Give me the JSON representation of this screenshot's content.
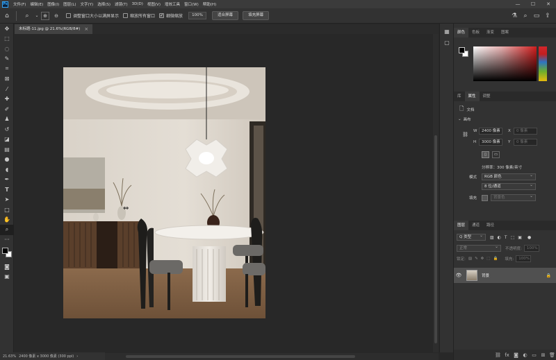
{
  "app": {
    "logo": "Ps",
    "menus": [
      "文件(F)",
      "编辑(E)",
      "图像(I)",
      "图层(L)",
      "文字(Y)",
      "选择(S)",
      "滤镜(T)",
      "3D(D)",
      "视图(V)",
      "增效工具",
      "窗口(W)",
      "帮助(H)"
    ],
    "window_controls": [
      "—",
      "☐",
      "✕"
    ]
  },
  "options_bar": {
    "checkbox_resize": "调整窗口大小以满屏显示",
    "checkbox_all_windows": "缩放所有窗口",
    "checkbox_scrubby": "细微缩放",
    "zoom_value": "100%",
    "fit_button": "适合屏幕",
    "fill_button": "填充屏幕"
  },
  "document": {
    "tab_title": "未标题-11.jpg @ 21.6%(RGB/8#)",
    "status_zoom": "21.63%",
    "status_size": "2400 像素 x 3000 像素 (300 ppi)"
  },
  "color_panel": {
    "tabs": [
      "颜色",
      "色板",
      "渐变",
      "图案"
    ],
    "fg": "#000000",
    "bg": "#ffffff"
  },
  "properties_panel": {
    "tabs": [
      "库",
      "属性",
      "调整"
    ],
    "doc_label": "文档",
    "canvas_section": "画布",
    "w_label": "W",
    "w_value": "2400 像素",
    "h_label": "H",
    "h_value": "3000 像素",
    "x_label": "X",
    "x_value": "0 像素",
    "y_label": "Y",
    "y_value": "0 像素",
    "resolution": "分辨率：300 像素/英寸",
    "mode_label": "模式",
    "mode_value": "RGB 颜色",
    "depth_value": "8 位/通道",
    "fill_label": "填充",
    "fill_value": "背景色"
  },
  "layers_panel": {
    "tabs": [
      "图层",
      "通道",
      "路径"
    ],
    "search_placeholder": "Q 类型",
    "blend_mode": "正常",
    "opacity_label": "不透明度:",
    "opacity_value": "100%",
    "lock_label": "锁定:",
    "fill_label": "填充:",
    "fill_value": "100%",
    "layer_name": "背景"
  }
}
